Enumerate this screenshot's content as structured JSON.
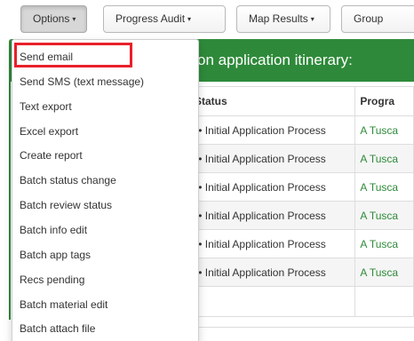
{
  "toolbar": {
    "options_label": "Options",
    "progress_audit_label": "Progress Audit",
    "map_results_label": "Map Results",
    "group_label": "Group",
    "caret": "▾"
  },
  "panel": {
    "title": "on application itinerary:"
  },
  "table": {
    "headers": {
      "status": "Status",
      "program": "Progra"
    },
    "rows": [
      {
        "status": "•• Initial Application Process",
        "program": "A Tusca"
      },
      {
        "status": "•• Initial Application Process",
        "program": "A Tusca"
      },
      {
        "status": "•• Initial Application Process",
        "program": "A Tusca"
      },
      {
        "status": "•• Initial Application Process",
        "program": "A Tusca"
      },
      {
        "status": "•• Initial Application Process",
        "program": "A Tusca"
      },
      {
        "status": "•• Initial Application Process",
        "program": "A Tusca"
      }
    ]
  },
  "options_menu": {
    "items": [
      "Send email",
      "Send SMS (text message)",
      "Text export",
      "Excel export",
      "Create report",
      "Batch status change",
      "Batch review status",
      "Batch info edit",
      "Batch app tags",
      "Recs pending",
      "Batch material edit",
      "Batch attach file"
    ]
  },
  "colors": {
    "header_green": "#2e8a3a",
    "link_green": "#2e8a3a",
    "highlight_red": "#e8202a"
  }
}
